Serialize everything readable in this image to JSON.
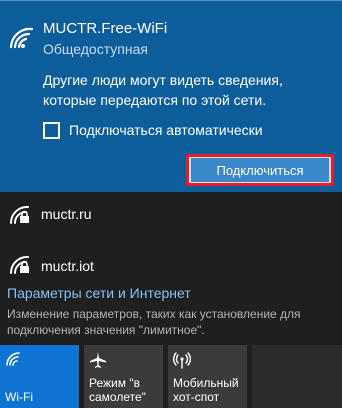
{
  "selected_network": {
    "name": "MUCTR.Free-WiFi",
    "status": "Общедоступная",
    "warning": "Другие люди могут видеть сведения, которые передаются по этой сети.",
    "auto_connect_label": "Подключаться автоматически",
    "auto_connect_checked": false,
    "connect_label": "Подключиться"
  },
  "networks": [
    {
      "name": "muctr.ru",
      "secured": true
    },
    {
      "name": "muctr.iot",
      "secured": true
    }
  ],
  "settings": {
    "link": "Параметры сети и Интернет",
    "description": "Изменение параметров, таких как установление для подключения значения \"лимитное\"."
  },
  "quick_actions": [
    {
      "label": "Wi-Fi",
      "icon": "wifi-icon",
      "active": true
    },
    {
      "label": "Режим \"в самолете\"",
      "icon": "airplane-icon",
      "active": false
    },
    {
      "label": "Мобильный хот-спот",
      "icon": "hotspot-icon",
      "active": false
    }
  ],
  "colors": {
    "accent": "#0e74d4",
    "selected_bg": "#0e5e9c",
    "highlight_border": "#e0202a",
    "panel_bg": "#1f1f1f",
    "link": "#87c1f2"
  }
}
